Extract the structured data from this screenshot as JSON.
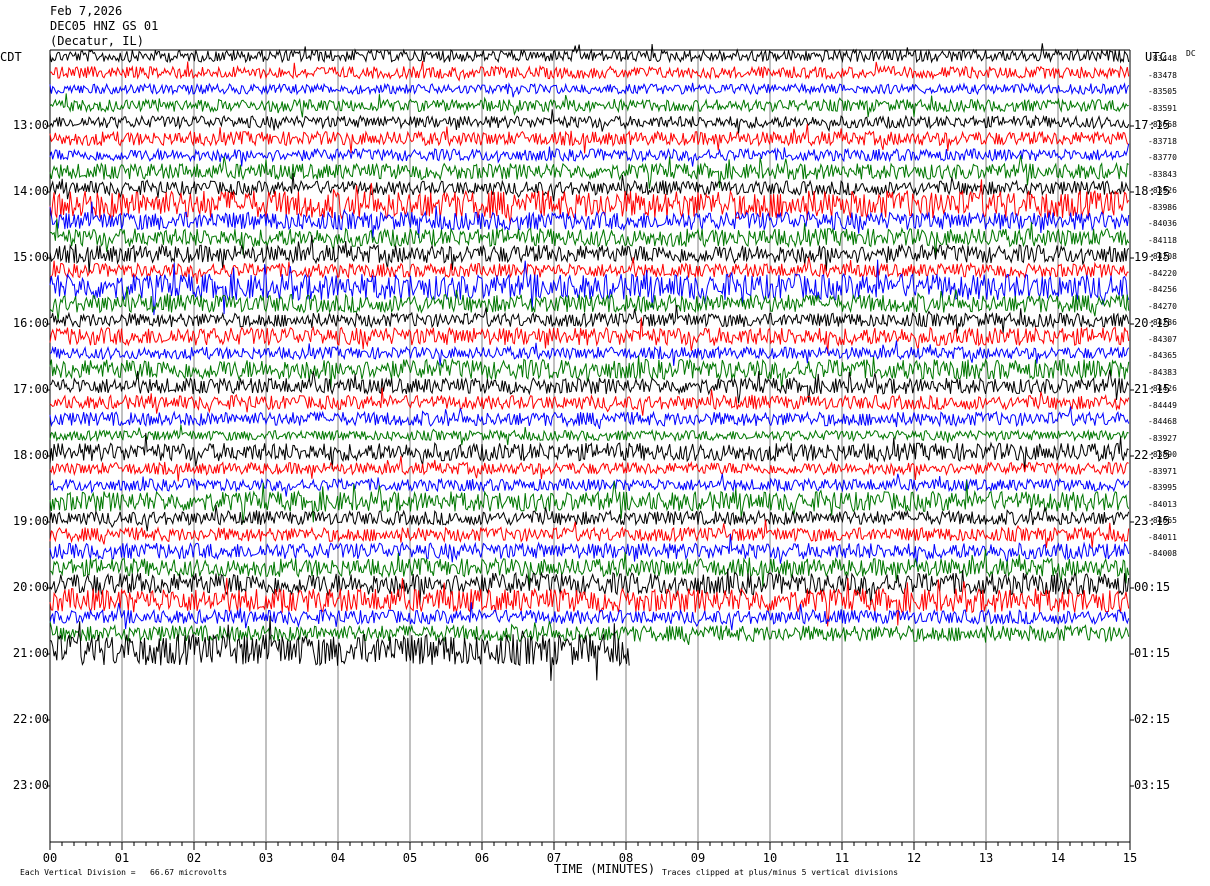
{
  "header": {
    "date": "Feb 7,2026",
    "station": "DEC05 HNZ GS 01",
    "location": "(Decatur, IL)"
  },
  "axis_tags": {
    "left": "CDT",
    "right": "UTC",
    "dc": "DC"
  },
  "footer": {
    "scale_note": "Each Vertical Division =   66.67 microvolts",
    "xlabel": "TIME (MINUTES)",
    "clip_note": "Traces clipped at plus/minus 5 vertical divisions"
  },
  "colors": {
    "black": "#000000",
    "red": "#ff0000",
    "blue": "#0000ff",
    "green": "#007700",
    "grid": "#808080"
  },
  "chart_data": {
    "type": "line",
    "title": "DEC05 HNZ GS 01",
    "xlabel": "TIME (MINUTES)",
    "xlim": [
      0,
      15
    ],
    "x_ticks": [
      "00",
      "01",
      "02",
      "03",
      "04",
      "05",
      "06",
      "07",
      "08",
      "09",
      "10",
      "11",
      "12",
      "13",
      "14",
      "15"
    ],
    "left_time_labels": [
      "13:00",
      "14:00",
      "15:00",
      "16:00",
      "17:00",
      "18:00",
      "19:00",
      "20:00",
      "21:00",
      "22:00",
      "23:00"
    ],
    "right_time_labels": [
      "17:15",
      "18:15",
      "19:15",
      "20:15",
      "21:15",
      "22:15",
      "23:15",
      "00:15",
      "01:15",
      "02:15",
      "03:15"
    ],
    "trace_color_cycle": [
      "black",
      "red",
      "blue",
      "green"
    ],
    "dc_offsets": [
      "-83448",
      "-83478",
      "-83505",
      "-83591",
      "-83668",
      "-83718",
      "-83770",
      "-83843",
      "-83926",
      "-83986",
      "-84036",
      "-84118",
      "-84208",
      "-84220",
      "-84256",
      "-84270",
      "-84286",
      "-84307",
      "-84365",
      "-84383",
      "-84426",
      "-84449",
      "-84468",
      "-83927",
      "-83890",
      "-83971",
      "-83995",
      "-84013",
      "-84065",
      "-84011",
      "-84008"
    ],
    "trace_amplitude": [
      6,
      6,
      5,
      6,
      6,
      7,
      6,
      8,
      7,
      14,
      9,
      9,
      9,
      7,
      13,
      9,
      7,
      9,
      6,
      10,
      8,
      7,
      7,
      5,
      9,
      6,
      6,
      10,
      7,
      7,
      8,
      9,
      11,
      12,
      7,
      8,
      16
    ],
    "trace_end_minute": [
      15,
      15,
      15,
      15,
      15,
      15,
      15,
      15,
      15,
      15,
      15,
      15,
      15,
      15,
      15,
      15,
      15,
      15,
      15,
      15,
      15,
      15,
      15,
      15,
      15,
      15,
      15,
      15,
      15,
      15,
      15,
      15,
      15,
      15,
      15,
      15,
      8.05
    ],
    "vertical_division_microvolts": 66.67,
    "clip_divisions": 5
  }
}
